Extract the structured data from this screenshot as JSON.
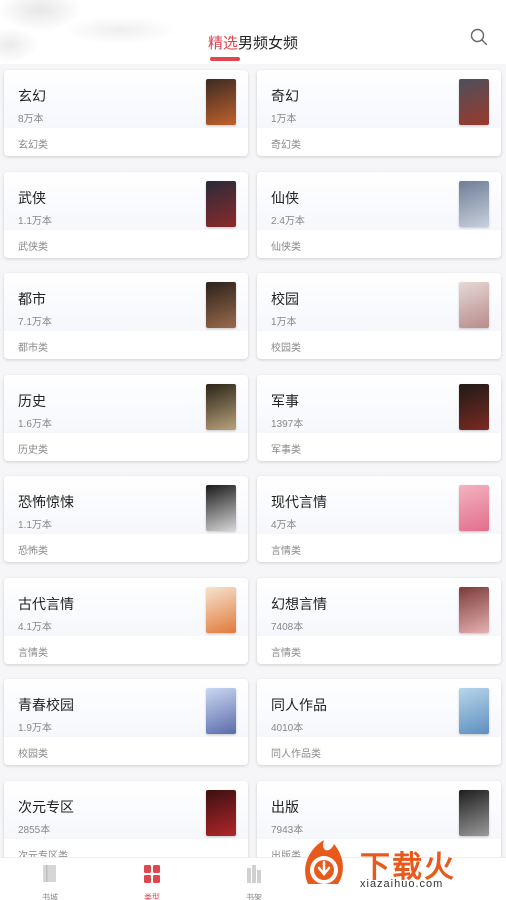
{
  "header": {
    "tabs": [
      {
        "label": "精选",
        "active": true
      },
      {
        "label": "男频",
        "active": false
      },
      {
        "label": "女频",
        "active": false
      }
    ],
    "search_icon": "search-icon"
  },
  "categories": [
    {
      "name": "玄幻",
      "count": "8万本",
      "type": "玄幻类",
      "cover_colors": [
        "#3b2a24",
        "#c2622b"
      ]
    },
    {
      "name": "奇幻",
      "count": "1万本",
      "type": "奇幻类",
      "cover_colors": [
        "#4c4f5c",
        "#9a3a2c"
      ]
    },
    {
      "name": "武侠",
      "count": "1.1万本",
      "type": "武侠类",
      "cover_colors": [
        "#2a2b3a",
        "#8a2a2a"
      ]
    },
    {
      "name": "仙侠",
      "count": "2.4万本",
      "type": "仙侠类",
      "cover_colors": [
        "#6f7d96",
        "#c8d0dc"
      ]
    },
    {
      "name": "都市",
      "count": "7.1万本",
      "type": "都市类",
      "cover_colors": [
        "#2b211c",
        "#9a6b4b"
      ]
    },
    {
      "name": "校园",
      "count": "1万本",
      "type": "校园类",
      "cover_colors": [
        "#e6d9d6",
        "#b78b8a"
      ]
    },
    {
      "name": "历史",
      "count": "1.6万本",
      "type": "历史类",
      "cover_colors": [
        "#2b2418",
        "#b9a37a"
      ]
    },
    {
      "name": "军事",
      "count": "1397本",
      "type": "军事类",
      "cover_colors": [
        "#1e1a18",
        "#7c2a22"
      ]
    },
    {
      "name": "恐怖惊悚",
      "count": "1.1万本",
      "type": "恐怖类",
      "cover_colors": [
        "#1a1a1a",
        "#d8d8d8"
      ]
    },
    {
      "name": "现代言情",
      "count": "4万本",
      "type": "言情类",
      "cover_colors": [
        "#f3b3c1",
        "#e36d8b"
      ]
    },
    {
      "name": "古代言情",
      "count": "4.1万本",
      "type": "言情类",
      "cover_colors": [
        "#f6e3d0",
        "#e07a3a"
      ]
    },
    {
      "name": "幻想言情",
      "count": "7408本",
      "type": "言情类",
      "cover_colors": [
        "#7c3a3a",
        "#e6b1b1"
      ]
    },
    {
      "name": "青春校园",
      "count": "1.9万本",
      "type": "校园类",
      "cover_colors": [
        "#cbd7f2",
        "#5a6cab"
      ]
    },
    {
      "name": "同人作品",
      "count": "4010本",
      "type": "同人作品类",
      "cover_colors": [
        "#b8d5ea",
        "#5d8fbf"
      ]
    },
    {
      "name": "次元专区",
      "count": "2855本",
      "type": "次元专区类",
      "cover_colors": [
        "#3b1010",
        "#b2262a"
      ]
    },
    {
      "name": "出版",
      "count": "7943本",
      "type": "出版类",
      "cover_colors": [
        "#1f1f1f",
        "#9a9a9a"
      ]
    }
  ],
  "bottom_nav": [
    {
      "label": "书城",
      "icon": "book-icon",
      "active": false
    },
    {
      "label": "类型",
      "icon": "grid-icon",
      "active": true
    },
    {
      "label": "书架",
      "icon": "shelf-icon",
      "active": false
    }
  ],
  "watermark": {
    "text": "下载火",
    "url": "xiazaihuo.com",
    "color": "#e85a1c"
  }
}
